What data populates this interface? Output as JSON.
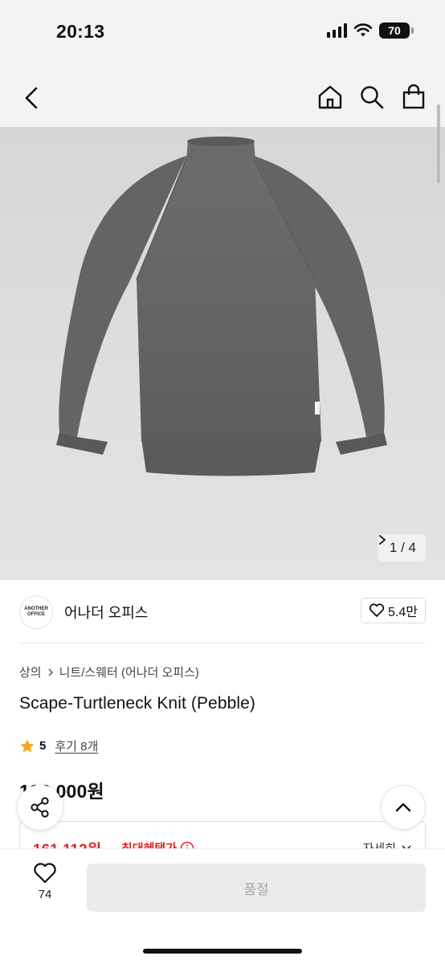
{
  "status_bar": {
    "time": "20:13",
    "battery": "70"
  },
  "hero": {
    "image_alt": "Gray turtleneck knit sweater",
    "counter": "1 / 4"
  },
  "brand": {
    "logo_line1": "ANOTHER",
    "logo_line2": "OFFICE",
    "name": "어나더 오피스",
    "likes": "5.4만"
  },
  "breadcrumb": {
    "level1": "상의",
    "level2": "니트/스웨터 (어나더 오피스)"
  },
  "product": {
    "title": "Scape-Turtleneck Knit (Pebble)",
    "rating": "5",
    "reviews": "후기 8개",
    "price": "192,000원"
  },
  "benefit": {
    "price": "161,112원",
    "label": "최대혜택가",
    "detail": "자세히"
  },
  "bottom_bar": {
    "wish_count": "74",
    "buy_label": "품절"
  },
  "colors": {
    "accent_red": "#e0242a",
    "star": "#f5a623",
    "soldout_bg": "#ebebeb"
  },
  "icons": [
    "back-icon",
    "home-icon",
    "search-icon",
    "bag-icon",
    "heart-icon",
    "chevron-right-icon",
    "star-icon",
    "info-icon",
    "chevron-down-icon",
    "share-icon",
    "chevron-up-icon"
  ]
}
